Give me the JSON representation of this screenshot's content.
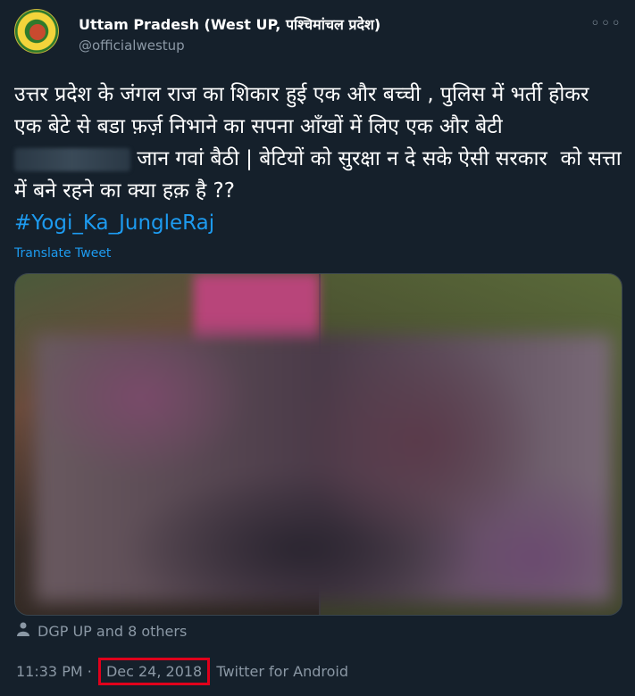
{
  "header": {
    "name": "Uttam Pradesh (West UP, पश्चिमांचल प्रदेश)",
    "handle": "@officialwestup",
    "more": "◦◦◦"
  },
  "tweet": {
    "text_part1": "उत्तर प्रदेश के जंगल राज का शिकार हुई एक और बच्ची , पुलिस में भर्ती होकर एक बेटे से बडा फ़र्ज़ निभाने का सपना आँखों में लिए एक और बेटी ",
    "text_part2": " जान गवां बैठी | बेटियों को सुरक्षा न दे सके ऐसी सरकार  को सत्ता में बने रहने का क्या हक़ है ??",
    "hashtag": "#Yogi_Ka_JungleRaj",
    "translate": "Translate Tweet"
  },
  "liked_by": "DGP UP and 8 others",
  "meta": {
    "time": "11:33 PM",
    "separator": "·",
    "date": "Dec 24, 2018",
    "source": "Twitter for Android"
  },
  "colors": {
    "background": "#15202b",
    "link": "#1d9bf0",
    "secondary": "#8b98a5",
    "highlight_box": "#e0001b"
  }
}
